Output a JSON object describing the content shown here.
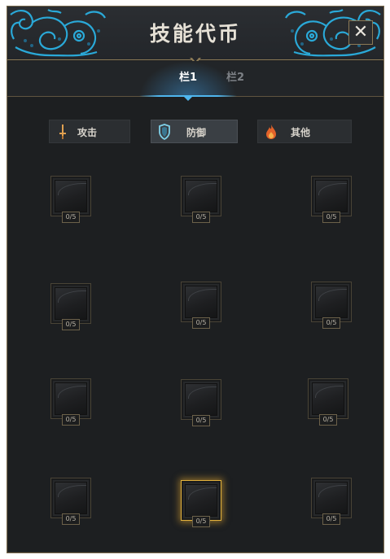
{
  "header": {
    "title": "技能代币",
    "close_label": "✕"
  },
  "tabs": [
    {
      "label": "栏1",
      "active": true
    },
    {
      "label": "栏2",
      "active": false
    }
  ],
  "categories": [
    {
      "label": "攻击",
      "icon": "sword-icon",
      "selected": false
    },
    {
      "label": "防御",
      "icon": "shield-icon",
      "selected": true
    },
    {
      "label": "其他",
      "icon": "fire-icon",
      "selected": false
    }
  ],
  "slots": [
    {
      "count": "0/5"
    },
    {
      "count": "0/5"
    },
    {
      "count": "0/5"
    },
    {
      "count": "0/5"
    },
    {
      "count": "0/5"
    },
    {
      "count": "0/5"
    },
    {
      "count": "0/5"
    },
    {
      "count": "0/5"
    },
    {
      "count": "0/5"
    },
    {
      "count": "0/5"
    },
    {
      "count": "0/5",
      "highlighted": true
    },
    {
      "count": "0/5"
    }
  ],
  "colors": {
    "accent_blue": "#4fb6ee",
    "gold_border": "#8c7a56",
    "highlight": "#e3b23c",
    "ornament": "#2aa9d8"
  }
}
